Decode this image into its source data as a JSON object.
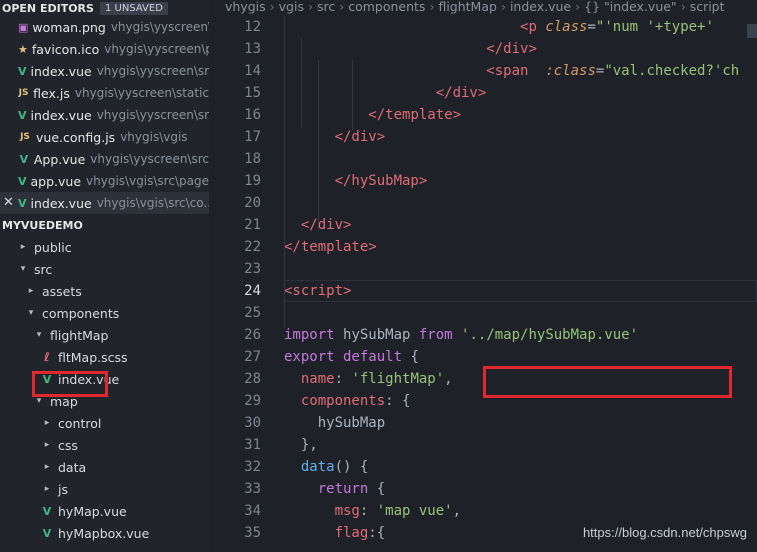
{
  "sidebar": {
    "open_editors_title": "OPEN EDITORS",
    "unsaved_badge": "1 UNSAVED",
    "open_editors": [
      {
        "name": "woman.png",
        "path": "vhygis\\yyscreen\\...",
        "icon": "image-icon"
      },
      {
        "name": "favicon.ico",
        "path": "vhygis\\yyscreen\\p...",
        "icon": "star-icon"
      },
      {
        "name": "index.vue",
        "path": "vhygis\\yyscreen\\src...",
        "icon": "vue-icon"
      },
      {
        "name": "flex.js",
        "path": "vhygis\\yyscreen\\static",
        "icon": "js-icon"
      },
      {
        "name": "index.vue",
        "path": "vhygis\\yyscreen\\src...",
        "icon": "vue-icon"
      },
      {
        "name": "vue.config.js",
        "path": "vhygis\\vgis",
        "icon": "js-icon"
      },
      {
        "name": "App.vue",
        "path": "vhygis\\yyscreen\\src",
        "icon": "vue-icon"
      },
      {
        "name": "app.vue",
        "path": "vhygis\\vgis\\src\\page...",
        "icon": "vue-icon"
      },
      {
        "name": "index.vue",
        "path": "vhygis\\vgis\\src\\co...",
        "icon": "vue-icon"
      }
    ],
    "project_title": "MYVUEDEMO",
    "tree": [
      {
        "label": "public",
        "type": "folder",
        "state": "collapsed"
      },
      {
        "label": "src",
        "type": "folder",
        "state": "expanded"
      },
      {
        "label": "assets",
        "type": "folder",
        "state": "collapsed"
      },
      {
        "label": "components",
        "type": "folder",
        "state": "expanded"
      },
      {
        "label": "flightMap",
        "type": "folder",
        "state": "expanded"
      },
      {
        "label": "fltMap.scss",
        "type": "file",
        "icon": "scss-icon"
      },
      {
        "label": "index.vue",
        "type": "file",
        "icon": "vue-icon"
      },
      {
        "label": "map",
        "type": "folder",
        "state": "expanded"
      },
      {
        "label": "control",
        "type": "folder",
        "state": "collapsed"
      },
      {
        "label": "css",
        "type": "folder",
        "state": "collapsed"
      },
      {
        "label": "data",
        "type": "folder",
        "state": "collapsed"
      },
      {
        "label": "js",
        "type": "folder",
        "state": "collapsed"
      },
      {
        "label": "hyMap.vue",
        "type": "file",
        "icon": "vue-icon"
      },
      {
        "label": "hyMapbox.vue",
        "type": "file",
        "icon": "vue-icon"
      }
    ]
  },
  "breadcrumb": [
    "vhygis",
    "vgis",
    "src",
    "components",
    "flightMap",
    "index.vue",
    "{} \"index.vue\"",
    "script"
  ],
  "editor": {
    "lines": [
      {
        "n": "12",
        "indent": 14,
        "tokens": [
          [
            "tag",
            "<p "
          ],
          [
            "attr",
            "class"
          ],
          [
            "pl",
            "="
          ],
          [
            "str",
            "\"'num '+type+'"
          ]
        ]
      },
      {
        "n": "13",
        "indent": 12,
        "tokens": [
          [
            "tag",
            "</div>"
          ]
        ]
      },
      {
        "n": "14",
        "indent": 12,
        "tokens": [
          [
            "tag",
            "<span  "
          ],
          [
            "attr",
            ":class"
          ],
          [
            "pl",
            "="
          ],
          [
            "str",
            "\"val.checked?'ch"
          ]
        ]
      },
      {
        "n": "15",
        "indent": 9,
        "tokens": [
          [
            "tag",
            "</div>"
          ]
        ]
      },
      {
        "n": "16",
        "indent": 5,
        "tokens": [
          [
            "tag",
            "</template>"
          ]
        ]
      },
      {
        "n": "17",
        "indent": 3,
        "tokens": [
          [
            "tag",
            "</div>"
          ]
        ]
      },
      {
        "n": "18",
        "indent": 0,
        "tokens": []
      },
      {
        "n": "19",
        "indent": 3,
        "tokens": [
          [
            "tag",
            "</hySubMap>"
          ]
        ]
      },
      {
        "n": "20",
        "indent": 0,
        "tokens": []
      },
      {
        "n": "21",
        "indent": 1,
        "tokens": [
          [
            "tag",
            "</div>"
          ]
        ]
      },
      {
        "n": "22",
        "indent": 0,
        "tokens": [
          [
            "tag",
            "</template>"
          ]
        ]
      },
      {
        "n": "23",
        "indent": 0,
        "tokens": []
      },
      {
        "n": "24",
        "indent": 0,
        "tokens": [
          [
            "tag",
            "<script>"
          ]
        ],
        "current": true
      },
      {
        "n": "25",
        "indent": 0,
        "tokens": []
      },
      {
        "n": "26",
        "indent": 0,
        "tokens": [
          [
            "kw",
            "import "
          ],
          [
            "pl",
            "hySubMap "
          ],
          [
            "kw",
            "from "
          ],
          [
            "str",
            "'../map/hySubMap.vue'"
          ]
        ]
      },
      {
        "n": "27",
        "indent": 0,
        "tokens": [
          [
            "kw",
            "export default "
          ],
          [
            "pl",
            "{"
          ]
        ]
      },
      {
        "n": "28",
        "indent": 1,
        "tokens": [
          [
            "prop",
            "name"
          ],
          [
            "pl",
            ": "
          ],
          [
            "str",
            "'flightMap'"
          ],
          [
            "pl",
            ","
          ]
        ]
      },
      {
        "n": "29",
        "indent": 1,
        "tokens": [
          [
            "prop",
            "components"
          ],
          [
            "pl",
            ": {"
          ]
        ]
      },
      {
        "n": "30",
        "indent": 2,
        "tokens": [
          [
            "pl",
            "hySubMap"
          ]
        ]
      },
      {
        "n": "31",
        "indent": 1,
        "tokens": [
          [
            "pl",
            "},"
          ]
        ]
      },
      {
        "n": "32",
        "indent": 1,
        "tokens": [
          [
            "fn",
            "data"
          ],
          [
            "pl",
            "() {"
          ]
        ]
      },
      {
        "n": "33",
        "indent": 2,
        "tokens": [
          [
            "kw",
            "return "
          ],
          [
            "pl",
            "{"
          ]
        ]
      },
      {
        "n": "34",
        "indent": 3,
        "tokens": [
          [
            "prop",
            "msg"
          ],
          [
            "pl",
            ": "
          ],
          [
            "str",
            "'map vue'"
          ],
          [
            "pl",
            ","
          ]
        ]
      },
      {
        "n": "35",
        "indent": 3,
        "tokens": [
          [
            "prop",
            "flag"
          ],
          [
            "pl",
            ":{"
          ]
        ]
      }
    ]
  },
  "watermark": "https://blog.csdn.net/chpswg",
  "colors": {
    "highlight": "#e0282e",
    "vue": "#41b883"
  }
}
